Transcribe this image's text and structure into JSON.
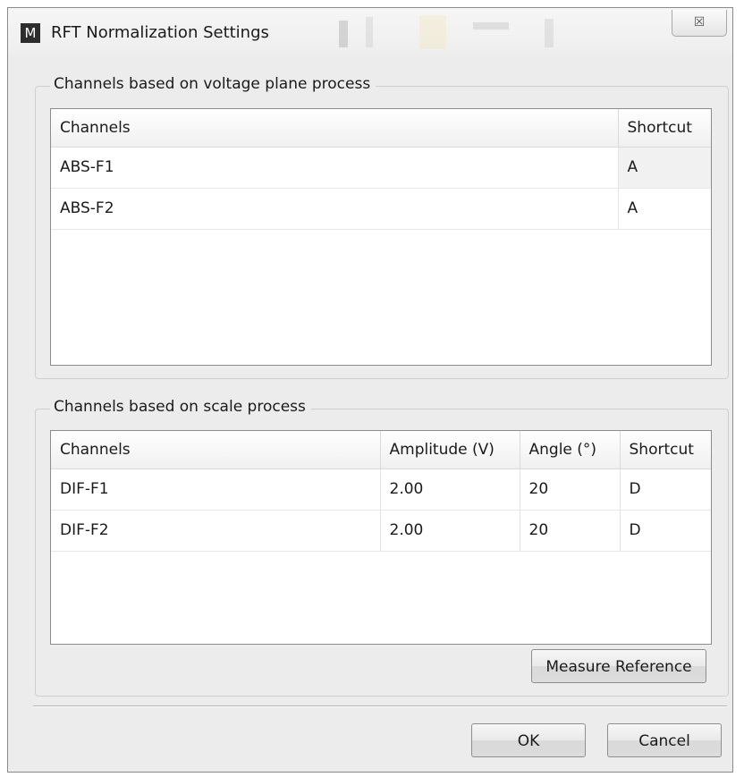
{
  "window": {
    "app_icon_letter": "M",
    "title": "RFT Normalization Settings",
    "close_glyph": "☒",
    "icons": {
      "close": "close-icon",
      "app": "app-logo-icon"
    }
  },
  "voltage_group": {
    "title": "Channels based on voltage plane process",
    "columns": [
      "Channels",
      "Shortcut"
    ],
    "rows": [
      {
        "channel": "ABS-F1",
        "shortcut": "A"
      },
      {
        "channel": "ABS-F2",
        "shortcut": "A"
      }
    ]
  },
  "scale_group": {
    "title": "Channels based on scale process",
    "columns": [
      "Channels",
      "Amplitude (V)",
      "Angle (°)",
      "Shortcut"
    ],
    "rows": [
      {
        "channel": "DIF-F1",
        "amplitude": "2.00",
        "angle": "20",
        "shortcut": "D"
      },
      {
        "channel": "DIF-F2",
        "amplitude": "2.00",
        "angle": "20",
        "shortcut": "D"
      }
    ],
    "measure_label": "Measure Reference"
  },
  "footer": {
    "ok_label": "OK",
    "cancel_label": "Cancel"
  }
}
